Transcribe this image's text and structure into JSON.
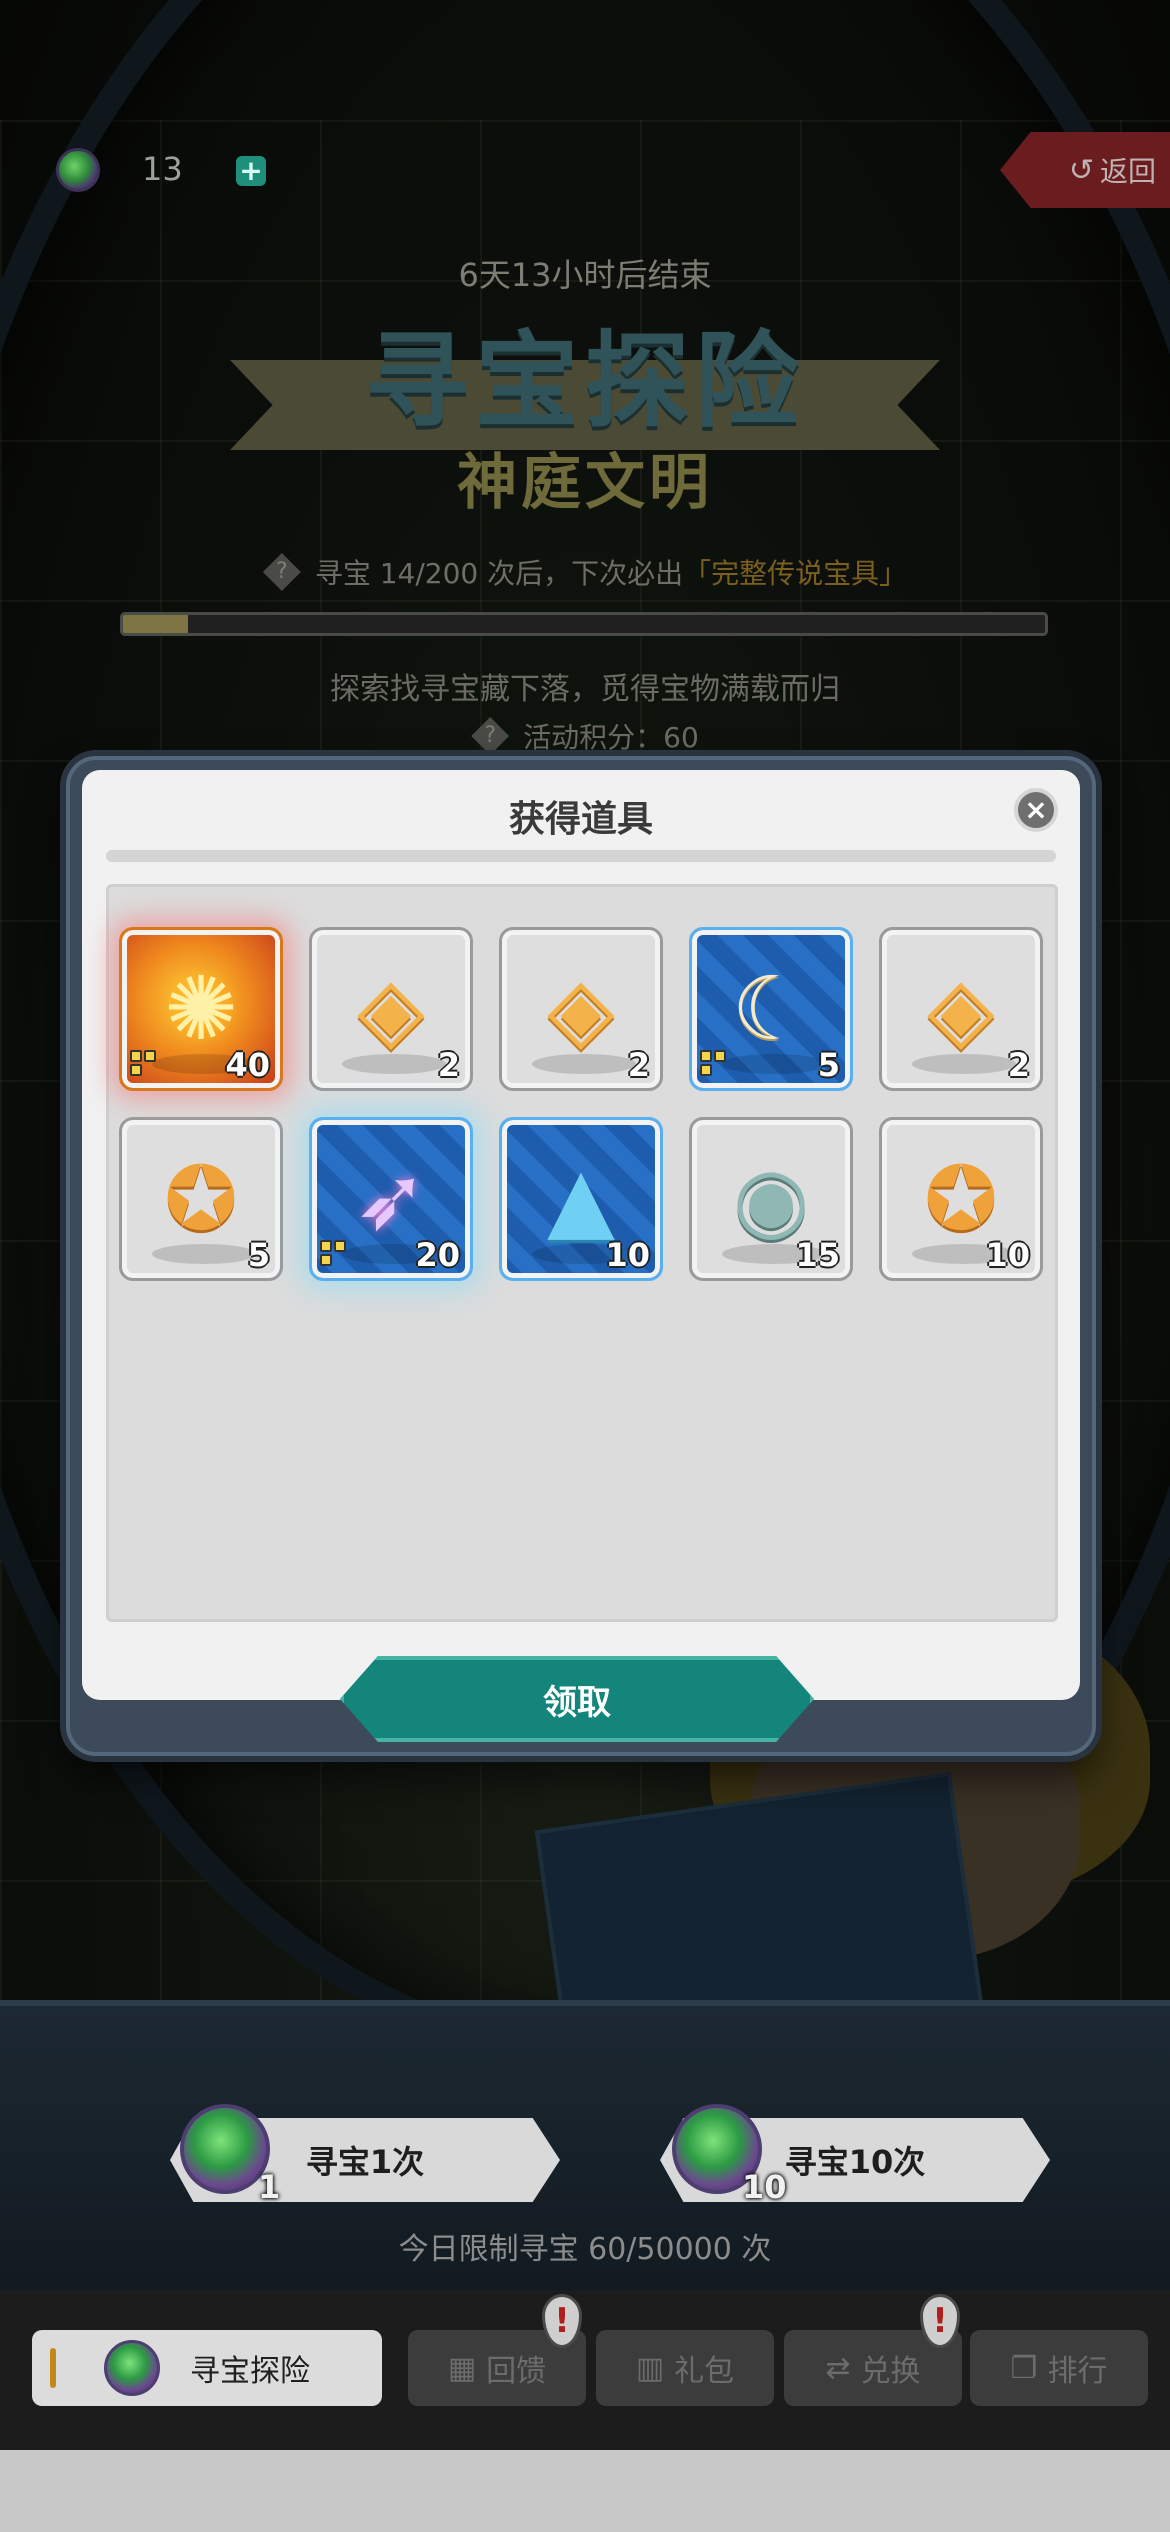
{
  "top_bar": {
    "currency_count": "13",
    "plus_symbol": "+",
    "back_label": "返回",
    "back_icon": "↺"
  },
  "event": {
    "countdown": "6天13小时后结束",
    "title": "寻宝探险",
    "subtitle": "神庭文明",
    "pity_text": "寻宝 14/200 次后，下次必出",
    "pity_highlight": "「完整传说宝具」",
    "pity_progress": 0.07,
    "description": "探索找寻宝藏下落，觅得宝物满载而归",
    "score": "活动积分：60",
    "help_icon": "?"
  },
  "modal": {
    "title": "获得道具",
    "close_symbol": "×",
    "claim_label": "领取",
    "items": [
      {
        "icon": "fire-scroll-icon",
        "qty": "40"
      },
      {
        "icon": "orange-cube-icon",
        "qty": "2"
      },
      {
        "icon": "orange-cube-icon",
        "qty": "2"
      },
      {
        "icon": "crescent-moon-icon",
        "qty": "5"
      },
      {
        "icon": "orange-cube-icon",
        "qty": "2"
      },
      {
        "icon": "gold-medal-icon",
        "qty": "5"
      },
      {
        "icon": "rocket-charm-icon",
        "qty": "20"
      },
      {
        "icon": "blue-slime-icon",
        "qty": "10"
      },
      {
        "icon": "stone-disc-icon",
        "qty": "15"
      },
      {
        "icon": "gold-medal-icon",
        "qty": "10"
      }
    ]
  },
  "draw": {
    "single_label": "寻宝1次",
    "single_cost": "1",
    "multi_label": "寻宝10次",
    "multi_cost": "10",
    "daily_limit": "今日限制寻宝 60/50000 次"
  },
  "tabs": {
    "treasure": "寻宝探险",
    "feedback": "回馈",
    "gift": "礼包",
    "exchange": "兑换",
    "ranking": "排行",
    "alert_symbol": "!"
  },
  "colors": {
    "accent_teal": "#14857a",
    "highlight_gold": "#7a5f1e",
    "back_red": "#6b1c1f"
  }
}
